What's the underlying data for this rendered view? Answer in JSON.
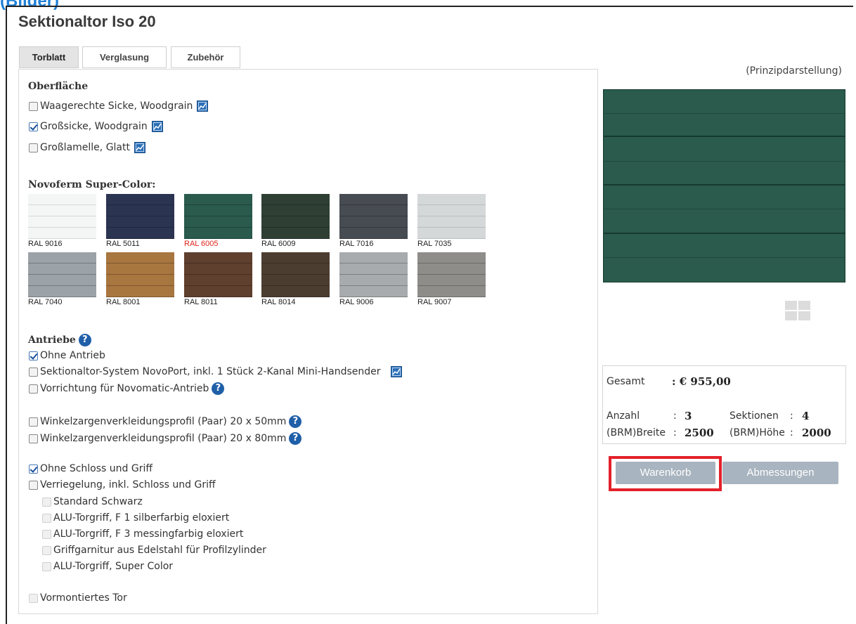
{
  "corner_label": "(Bilder)",
  "title": "Sektionaltor Iso 20",
  "tabs": [
    {
      "label": "Torblatt",
      "active": true
    },
    {
      "label": "Verglasung",
      "active": false
    },
    {
      "label": "Zubehör",
      "active": false
    }
  ],
  "oberflaeche": {
    "heading": "Oberfläche",
    "options": [
      {
        "label": "Waagerechte Sicke, Woodgrain",
        "checked": false
      },
      {
        "label": "Großsicke, Woodgrain",
        "checked": true
      },
      {
        "label": "Großlamelle, Glatt",
        "checked": false
      }
    ]
  },
  "colors": {
    "heading": "Novoferm Super-Color:",
    "selected": "RAL 6005",
    "swatches": [
      {
        "label": "RAL 9016",
        "hex": "#f4f5f5"
      },
      {
        "label": "RAL 5011",
        "hex": "#2b3552"
      },
      {
        "label": "RAL 6005",
        "hex": "#2a5b4c"
      },
      {
        "label": "RAL 6009",
        "hex": "#2f3f34"
      },
      {
        "label": "RAL 7016",
        "hex": "#474b52"
      },
      {
        "label": "RAL 7035",
        "hex": "#d4d8d8"
      },
      {
        "label": "RAL 7040",
        "hex": "#9ba2a8"
      },
      {
        "label": "RAL 8001",
        "hex": "#a8763f"
      },
      {
        "label": "RAL 8011",
        "hex": "#5f3f2e"
      },
      {
        "label": "RAL 8014",
        "hex": "#4c3d31"
      },
      {
        "label": "RAL 9006",
        "hex": "#a7abae"
      },
      {
        "label": "RAL 9007",
        "hex": "#8e8d8a"
      }
    ]
  },
  "antriebe": {
    "heading": "Antriebe",
    "options": [
      {
        "label": "Ohne Antrieb",
        "checked": true
      },
      {
        "label": "Sektionaltor-System NovoPort, inkl. 1 Stück 2-Kanal Mini-Handsender",
        "checked": false
      },
      {
        "label": "Vorrichtung für Novomatic-Antrieb",
        "checked": false
      }
    ]
  },
  "zargen": [
    {
      "label": "Winkelzargenverkleidungsprofil (Paar) 20 x 50mm",
      "checked": false
    },
    {
      "label": "Winkelzargenverkleidungsprofil (Paar) 20 x 80mm",
      "checked": false
    }
  ],
  "schloss": [
    {
      "label": "Ohne Schloss und Griff",
      "checked": true
    },
    {
      "label": "Verriegelung, inkl. Schloss und Griff",
      "checked": false
    }
  ],
  "griffe": [
    "Standard Schwarz",
    "ALU-Torgriff, F 1 silberfarbig eloxiert",
    "ALU-Torgriff, F 3 messingfarbig eloxiert",
    "Griffgarnitur aus Edelstahl für Profilzylinder",
    "ALU-Torgriff, Super Color"
  ],
  "vormontiert": "Vormontiertes Tor",
  "preview": {
    "caption": "(Prinzipdarstellung)",
    "door_color": "#2a5b4c"
  },
  "summary": {
    "gesamt_label": "Gesamt",
    "gesamt_value": ": € 955,00",
    "anzahl_label": "Anzahl",
    "anzahl_value": "3",
    "sektionen_label": "Sektionen",
    "sektionen_value": "4",
    "breite_label": "(BRM)Breite",
    "breite_value": "2500",
    "hoehe_label": "(BRM)Höhe",
    "hoehe_value": "2000",
    "colon": ":"
  },
  "buttons": {
    "cart": "Warenkorb",
    "dimensions": "Abmessungen"
  },
  "accent_highlight": "#e3202a"
}
